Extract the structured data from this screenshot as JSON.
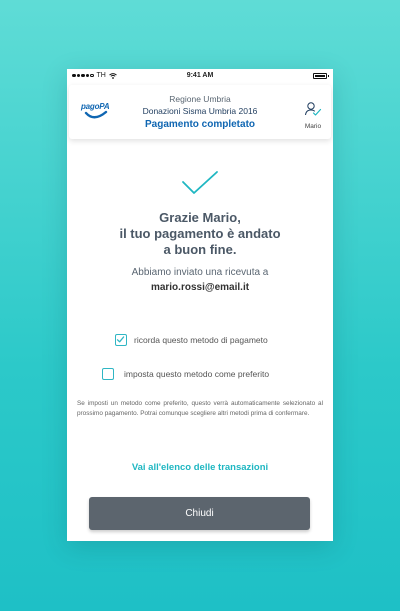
{
  "status_bar": {
    "carrier": "TH",
    "time": "9:41 AM"
  },
  "header": {
    "logo_text": "pagoPA",
    "region": "Regione Umbria",
    "title": "Donazioni Sisma Umbria 2016",
    "status": "Pagamento completato",
    "user_name": "Mario"
  },
  "confirmation": {
    "line1": "Grazie Mario,",
    "line2": "il tuo pagamento è andato",
    "line3": "a buon fine.",
    "receipt_text": "Abbiamo inviato una ricevuta a",
    "email": "mario.rossi@email.it"
  },
  "options": {
    "remember_label": "ricorda questo metodo di pagameto",
    "remember_checked": true,
    "preferred_label": "imposta questo metodo come preferito",
    "preferred_checked": false
  },
  "note": "Se imposti un metodo come preferito, questo verrà automaticamente selezionato al prossimo pagamento. Potrai comunque scegliere altri metodi prima di confermare.",
  "link_transactions": "Vai all'elenco delle transazioni",
  "close_button": "Chiudi",
  "colors": {
    "accent": "#1fb7c2",
    "brand_blue": "#0f66b2",
    "button": "#5c656e"
  }
}
